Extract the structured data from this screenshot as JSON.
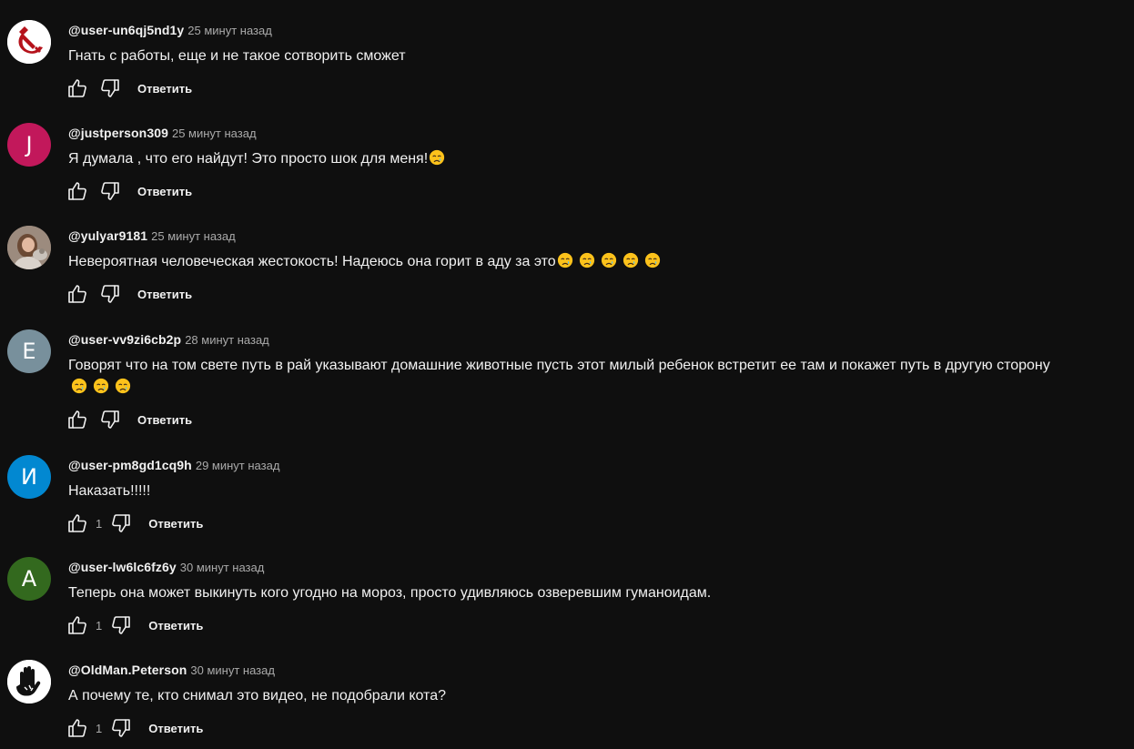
{
  "reply_label": "Ответить",
  "comments": [
    {
      "author": "@user-un6qj5nd1y",
      "time": "25 минут назад",
      "text": "Гнать с работы, еще и не такое сотворить сможет",
      "emoji_count": 0,
      "likes": "",
      "avatar": {
        "type": "icon",
        "icon": "hammer-sickle-icon",
        "bg": "#ffffff",
        "fg": "#b5121b"
      }
    },
    {
      "author": "@justperson309",
      "time": "25 минут назад",
      "text": "Я думала , что его найдут! Это просто шок для меня!",
      "emoji_count": 1,
      "likes": "",
      "avatar": {
        "type": "letter",
        "letter": "J",
        "bg": "#c2185b"
      }
    },
    {
      "author": "@yulyar9181",
      "time": "25 минут назад",
      "text": "Невероятная человеческая жестокость! Надеюсь она горит в аду за это",
      "emoji_count": 5,
      "likes": "",
      "avatar": {
        "type": "photo",
        "icon": "user-photo-icon",
        "bg": "#8a7a6c"
      }
    },
    {
      "author": "@user-vv9zi6cb2p",
      "time": "28 минут назад",
      "text": "Говорят что на том свете путь в рай указывают домашние животные пусть этот милый ребенок встретит ее там и покажет путь в другую сторону",
      "emoji_count": 3,
      "likes": "",
      "avatar": {
        "type": "letter",
        "letter": "E",
        "bg": "#78909c"
      }
    },
    {
      "author": "@user-pm8gd1cq9h",
      "time": "29 минут назад",
      "text": "Наказать!!!!!",
      "emoji_count": 0,
      "likes": "1",
      "avatar": {
        "type": "letter",
        "letter": "И",
        "bg": "#0288d1"
      }
    },
    {
      "author": "@user-lw6lc6fz6y",
      "time": "30 минут назад",
      "text": "Теперь она может выкинуть кого угодно на мороз, просто удивляюсь озверевшим гуманоидам.",
      "emoji_count": 0,
      "likes": "1",
      "avatar": {
        "type": "letter",
        "letter": "A",
        "bg": "#33691e"
      }
    },
    {
      "author": "@OldMan.Peterson",
      "time": "30 минут назад",
      "text": "А почему те, кто снимал это видео, не подобрали кота?",
      "emoji_count": 0,
      "likes": "1",
      "avatar": {
        "type": "icon",
        "icon": "hand-print-icon",
        "bg": "#ffffff",
        "fg": "#111111"
      }
    }
  ],
  "icons": {
    "like": "thumbs-up-icon",
    "dislike": "thumbs-down-icon",
    "emoji": "crying-face-emoji"
  },
  "colors": {
    "background": "#0f0f0f",
    "text": "#f1f1f1",
    "secondary": "#aaaaaa"
  }
}
